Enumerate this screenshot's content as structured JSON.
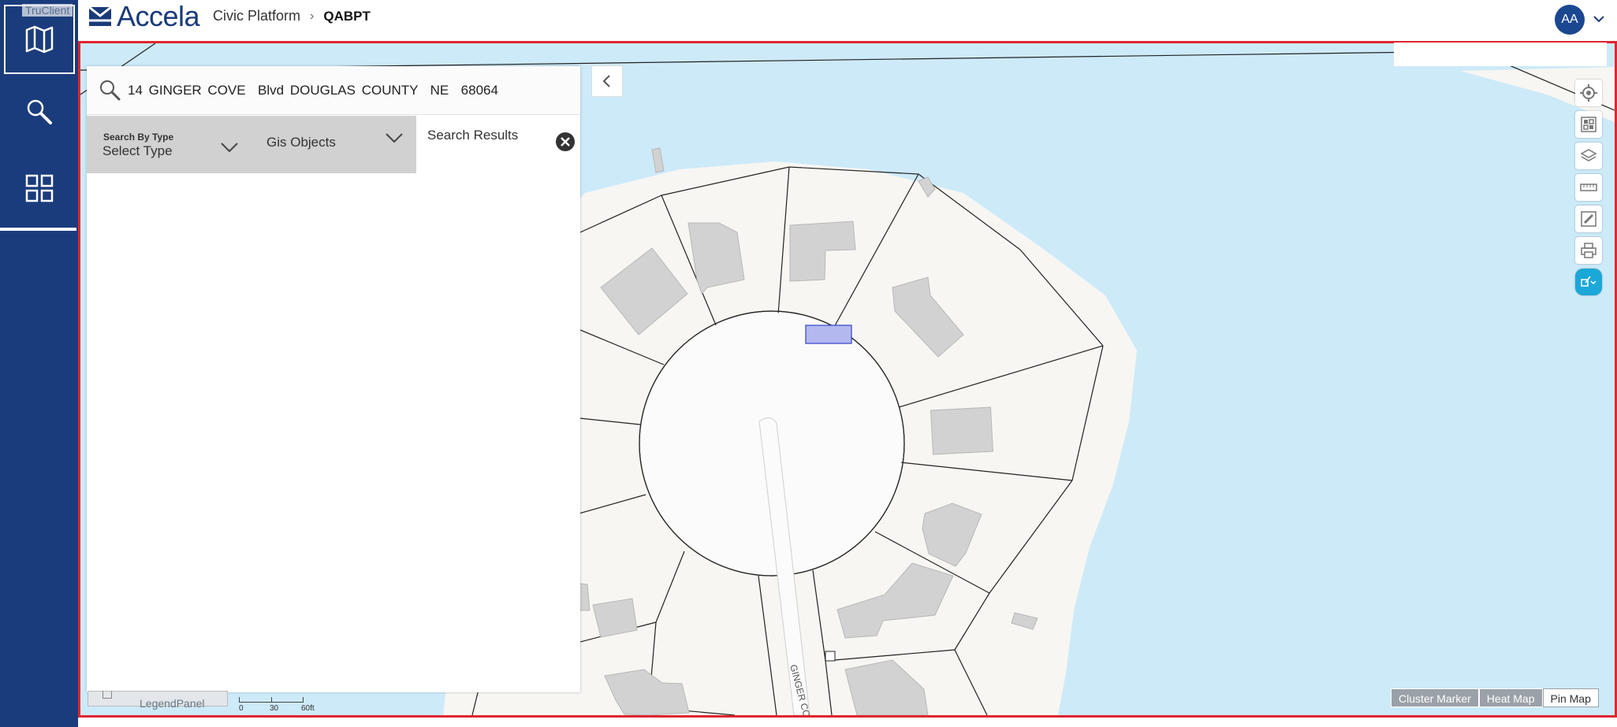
{
  "overlay": {
    "truclient_label": "TruClient"
  },
  "header": {
    "logo_text": "Accela",
    "breadcrumb": {
      "parent": "Civic Platform",
      "current": "QABPT"
    },
    "user_initials": "AA"
  },
  "nav": {
    "items": [
      {
        "name": "map",
        "icon": "map-icon"
      },
      {
        "name": "search",
        "icon": "search-icon"
      },
      {
        "name": "apps",
        "icon": "grid-icon"
      }
    ]
  },
  "search_panel": {
    "query": "14 GINGER COVE  Blvd DOUGLAS COUNTY  NE  68064",
    "search_by_type_label": "Search By Type",
    "search_by_type_value": "Select Type",
    "gis_objects_value": "Gis Objects",
    "results_title": "Search Results"
  },
  "map": {
    "street_label": "GINGER CO",
    "legend_label": "LegendPanel",
    "scale": {
      "zero": "0",
      "mid": "30",
      "end": "60ft"
    },
    "modes": [
      "Cluster Marker",
      "Heat Map",
      "Pin Map"
    ],
    "selected_mode": "Pin Map",
    "tools": [
      "target-icon",
      "select-grid-icon",
      "layers-icon",
      "ruler-icon",
      "edit-icon",
      "print-icon",
      "gis-tools-icon"
    ],
    "colors": {
      "water": "#cdeaf9",
      "land": "#f7f6f2",
      "building": "#d2d2d2",
      "highlight": "#b3b8ee",
      "nav": "#1b3c7c",
      "border": "#e0262f"
    }
  }
}
